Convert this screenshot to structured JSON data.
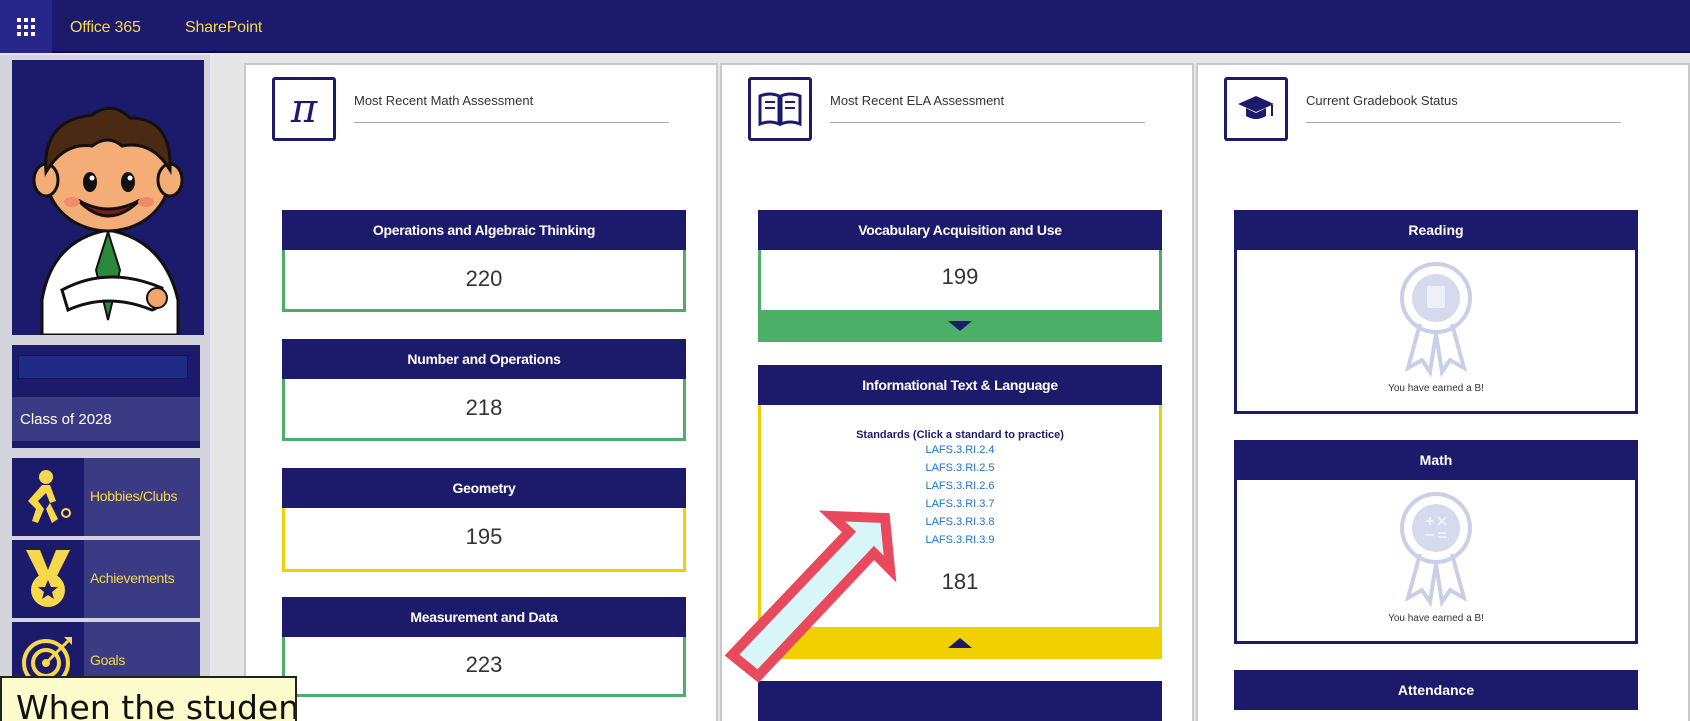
{
  "topbar": {
    "office_label": "Office 365",
    "sharepoint_label": "SharePoint"
  },
  "sidebar": {
    "class_label": "Class of 2028",
    "items": [
      {
        "label": "Hobbies/Clubs",
        "icon": "hiker-icon"
      },
      {
        "label": "Achievements",
        "icon": "medal-icon"
      },
      {
        "label": "Goals",
        "icon": "target-icon"
      }
    ]
  },
  "math": {
    "title": "Most Recent Math Assessment",
    "cards": [
      {
        "label": "Operations and Algebraic Thinking",
        "score": "220"
      },
      {
        "label": "Number and Operations",
        "score": "218"
      },
      {
        "label": "Geometry",
        "score": "195"
      },
      {
        "label": "Measurement and Data",
        "score": "223"
      }
    ]
  },
  "ela": {
    "title": "Most Recent ELA Assessment",
    "vocab": {
      "label": "Vocabulary Acquisition and Use",
      "score": "199"
    },
    "info": {
      "label": "Informational Text & Language",
      "standards_heading": "Standards (Click a standard to practice)",
      "standards": [
        "LAFS.3.RI.2.4",
        "LAFS.3.RI.2.5",
        "LAFS.3.RI.2.6",
        "LAFS.3.RI.3.7",
        "LAFS.3.RI.3.8",
        "LAFS.3.RI.3.9"
      ],
      "score": "181"
    }
  },
  "gradebook": {
    "title": "Current Gradebook Status",
    "cards": [
      {
        "label": "Reading",
        "earned": "You have earned a B!"
      },
      {
        "label": "Math",
        "earned": "You have earned a B!"
      },
      {
        "label": "Attendance"
      }
    ]
  },
  "callout": {
    "text": "When the student clicks on one of the links"
  },
  "colors": {
    "navy": "#1c1b6b",
    "gold": "#f7d84a",
    "green": "#4caf67",
    "yellow": "#f2d000",
    "link": "#1e73c8",
    "arrow_outline": "#e8495c",
    "arrow_fill": "#d8f6f8"
  }
}
